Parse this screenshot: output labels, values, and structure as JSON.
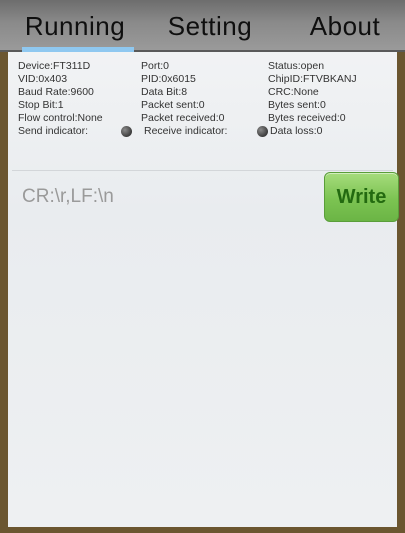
{
  "tabs": [
    {
      "label": "Running",
      "active": true
    },
    {
      "label": "Setting",
      "active": false
    },
    {
      "label": "About",
      "active": false
    }
  ],
  "status": {
    "rows": [
      [
        "Device:FT311D",
        "Port:0",
        "Status:open"
      ],
      [
        "VID:0x403",
        "PID:0x6015",
        "ChipID:FTVBKANJ"
      ],
      [
        "Baud Rate:9600",
        "Data Bit:8",
        "CRC:None"
      ],
      [
        "Stop Bit:1",
        "Packet sent:0",
        "Bytes sent:0"
      ],
      [
        "Flow control:None",
        "Packet received:0",
        "Bytes received:0"
      ]
    ],
    "send_indicator_label": "Send indicator:",
    "receive_indicator_label": "Receive indicator:",
    "data_loss_label": "Data loss:0"
  },
  "input": {
    "value": "CR:\\r,LF:\\n"
  },
  "write_label": "Write",
  "colors": {
    "tab_bar": "#8a8a8a",
    "tab_active_underline": "#8fc8f0",
    "write_button": "#7cc352",
    "frame": "#6b5630",
    "indicator": "#4a4a4a"
  }
}
